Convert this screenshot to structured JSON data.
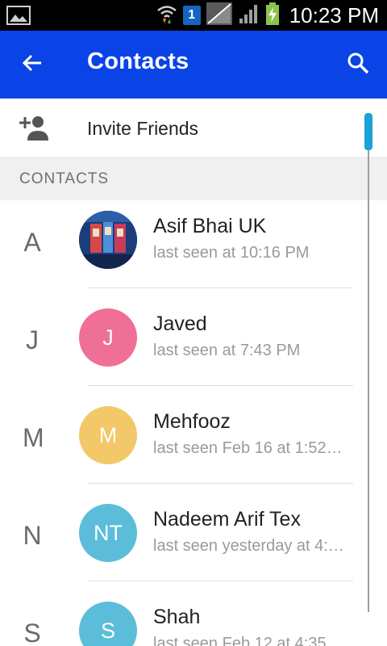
{
  "status_bar": {
    "time": "10:23 PM",
    "sim_label": "1",
    "icons": [
      "gallery-icon",
      "wifi-icon",
      "sim-icon",
      "no-signal-icon",
      "signal-icon",
      "battery-charging-icon"
    ]
  },
  "app_bar": {
    "title": "Contacts",
    "back_icon": "arrow-back-icon",
    "search_icon": "search-icon",
    "color": "#0a44e6"
  },
  "invite": {
    "label": "Invite Friends",
    "icon": "person-add-icon"
  },
  "section": {
    "label": "CONTACTS"
  },
  "contacts": [
    {
      "letter": "A",
      "name": "Asif Bhai UK",
      "status": "last seen at 10:16 PM",
      "initials": "",
      "avatar_color": "#1a3a6e",
      "photo": true
    },
    {
      "letter": "J",
      "name": "Javed",
      "status": "last seen at 7:43 PM",
      "initials": "J",
      "avatar_color": "#f06f96"
    },
    {
      "letter": "M",
      "name": "Mehfooz",
      "status": "last seen Feb 16 at 1:52…",
      "initials": "M",
      "avatar_color": "#f2c868"
    },
    {
      "letter": "N",
      "name": "Nadeem Arif Tex",
      "status": "last seen yesterday at 4:…",
      "initials": "NT",
      "avatar_color": "#5bbdd9"
    },
    {
      "letter": "S",
      "name": "Shah",
      "status": "last seen Feb 12 at 4:35",
      "initials": "S",
      "avatar_color": "#5bbdd9"
    }
  ]
}
